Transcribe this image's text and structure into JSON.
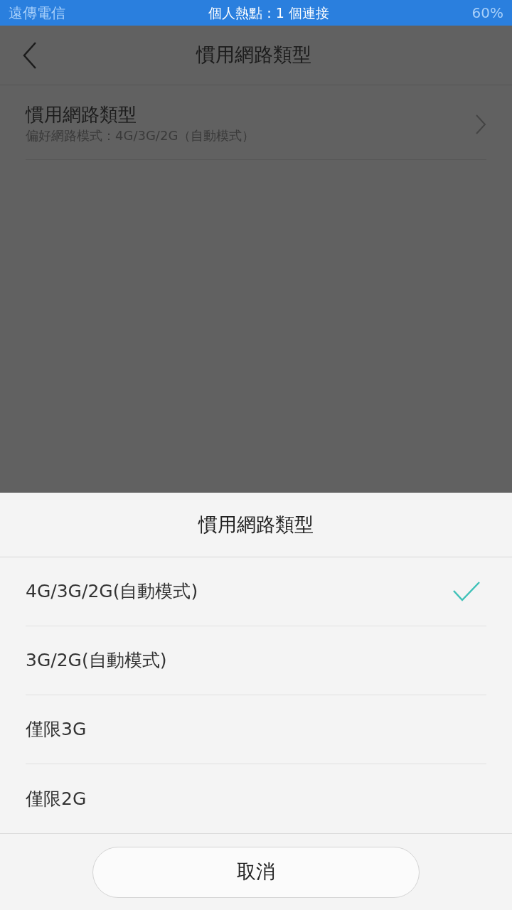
{
  "status_bar": {
    "carrier": "遠傳電信",
    "notice": "個人熱點：1 個連接",
    "battery": "60%"
  },
  "header": {
    "title": "慣用網路類型"
  },
  "settings": [
    {
      "title": "慣用網路類型",
      "summary": "偏好網路模式：4G/3G/2G（自動模式）"
    }
  ],
  "sheet": {
    "title": "慣用網路類型",
    "options": [
      {
        "label": "4G/3G/2G(自動模式)",
        "selected": true
      },
      {
        "label": "3G/2G(自動模式)",
        "selected": false
      },
      {
        "label": "僅限3G",
        "selected": false
      },
      {
        "label": "僅限2G",
        "selected": false
      }
    ],
    "cancel": "取消"
  }
}
